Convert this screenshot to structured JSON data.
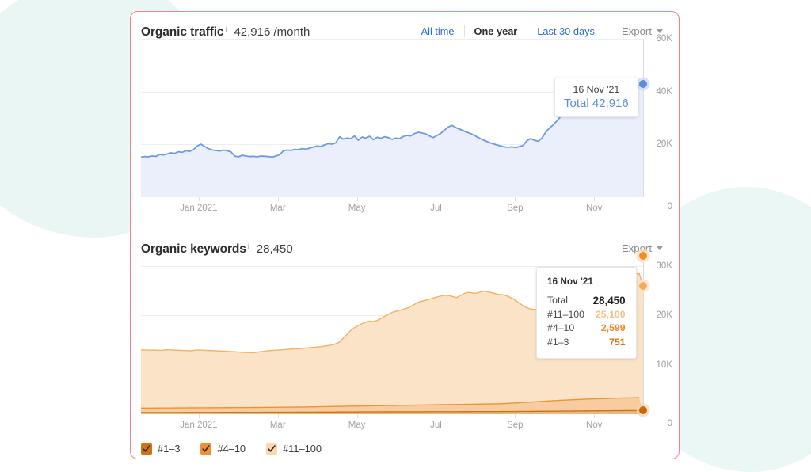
{
  "traffic": {
    "title": "Organic traffic",
    "info_icon": "i",
    "metric": "42,916 /month",
    "ranges": [
      {
        "label": "All time",
        "selected": false
      },
      {
        "label": "One year",
        "selected": true
      },
      {
        "label": "Last 30 days",
        "selected": false
      }
    ],
    "export_label": "Export",
    "tooltip": {
      "date": "16 Nov '21",
      "total_label": "Total",
      "total_value": "42,916"
    }
  },
  "keywords": {
    "title": "Organic keywords",
    "info_icon": "i",
    "metric": "28,450",
    "export_label": "Export",
    "tooltip": {
      "date": "16 Nov '21",
      "rows": [
        {
          "label": "Total",
          "value": "28,450",
          "color": "#1d1d1d"
        },
        {
          "label": "#11–100",
          "value": "25,100",
          "color": "#f5c08a"
        },
        {
          "label": "#4–10",
          "value": "2,599",
          "color": "#f18a2b"
        },
        {
          "label": "#1–3",
          "value": "751",
          "color": "#d9760f"
        }
      ]
    },
    "legend": [
      {
        "label": "#1–3",
        "color": "#cf7310",
        "checked": true
      },
      {
        "label": "#4–10",
        "color": "#f2912f",
        "checked": true
      },
      {
        "label": "#11–100",
        "color": "#fbd7ab",
        "checked": true
      }
    ]
  },
  "colors": {
    "card_border": "#f2828e",
    "blob": "#e9f6f4",
    "traffic_line": "#6d9ae0",
    "traffic_fill": "#eaeffb",
    "kw_11_100": "#fbe3c8",
    "kw_4_10": "#f7cda0",
    "kw_1_3": "#e08a2a",
    "link": "#2d6cdf"
  },
  "chart_data": [
    {
      "type": "area",
      "title": "Organic traffic",
      "subtitle": "42,916 /month",
      "xlabel": "",
      "ylabel": "",
      "ylim": [
        0,
        60000
      ],
      "yticks": [
        "0",
        "20K",
        "40K",
        "60K"
      ],
      "ytick_values": [
        0,
        20000,
        40000,
        60000
      ],
      "xticks": [
        "Jan 2021",
        "Mar",
        "May",
        "Jul",
        "Sep",
        "Nov"
      ],
      "grid": true,
      "legend_position": "none",
      "annotations": [
        {
          "date": "16 Nov '21",
          "label": "Total",
          "value": 42916
        }
      ],
      "series": [
        {
          "name": "Total",
          "color": "#6d9ae0",
          "values": [
            15200,
            15400,
            15300,
            15600,
            15500,
            16200,
            16000,
            16400,
            16800,
            16600,
            17200,
            17000,
            17600,
            17400,
            18000,
            19400,
            20100,
            19200,
            18400,
            17900,
            17700,
            17500,
            17900,
            17600,
            17200,
            15600,
            15300,
            15900,
            15600,
            15400,
            15500,
            15300,
            15600,
            15500,
            15400,
            15200,
            15600,
            16100,
            17600,
            17900,
            17700,
            18100,
            18000,
            18400,
            18200,
            18600,
            19000,
            19400,
            19200,
            19800,
            20300,
            20100,
            20600,
            22900,
            22000,
            22400,
            22200,
            23200,
            21600,
            22800,
            22400,
            23100,
            21800,
            22700,
            22300,
            22900,
            22600,
            21900,
            22400,
            22200,
            23000,
            23400,
            23200,
            24100,
            24600,
            24300,
            24000,
            23200,
            22600,
            23400,
            24200,
            25400,
            26600,
            27200,
            26400,
            25800,
            25200,
            24600,
            24100,
            23400,
            22600,
            21900,
            21300,
            20700,
            20200,
            19800,
            19400,
            19100,
            18900,
            19100,
            18800,
            19200,
            19600,
            21400,
            22200,
            21600,
            21200,
            22400,
            24600,
            26200,
            27400,
            28900,
            30600,
            31900,
            32800,
            33600,
            33200,
            34400,
            35600,
            36400,
            35600,
            34800,
            35800,
            36600,
            37400,
            38600,
            39400,
            40200,
            41400,
            40600,
            39800,
            40600,
            41800,
            42400,
            42916
          ]
        }
      ]
    },
    {
      "type": "stacked-area",
      "title": "Organic keywords",
      "subtitle": "28,450",
      "xlabel": "",
      "ylabel": "",
      "ylim": [
        0,
        32000
      ],
      "yticks": [
        "0",
        "10K",
        "20K",
        "30K"
      ],
      "ytick_values": [
        0,
        10000,
        20000,
        30000
      ],
      "xticks": [
        "Jan 2021",
        "Mar",
        "May",
        "Jul",
        "Sep",
        "Nov"
      ],
      "grid": true,
      "legend_position": "bottom",
      "annotations": [
        {
          "date": "16 Nov '21",
          "Total": 28450,
          "#11–100": 25100,
          "#4–10": 2599,
          "#1–3": 751
        }
      ],
      "series": [
        {
          "name": "#1–3",
          "color": "#cf7310",
          "values": [
            320,
            322,
            325,
            324,
            326,
            330,
            332,
            331,
            334,
            336,
            338,
            340,
            342,
            344,
            346,
            345,
            348,
            350,
            352,
            354,
            356,
            358,
            360,
            362,
            364,
            366,
            368,
            370,
            372,
            374,
            376,
            378,
            380,
            382,
            384,
            386,
            388,
            390,
            392,
            394,
            396,
            398,
            400,
            404,
            408,
            412,
            416,
            420,
            424,
            428,
            432,
            436,
            440,
            444,
            448,
            452,
            456,
            460,
            464,
            468,
            470,
            472,
            474,
            476,
            478,
            480,
            482,
            484,
            486,
            488,
            490,
            492,
            494,
            496,
            498,
            500,
            502,
            504,
            506,
            508,
            510,
            512,
            514,
            516,
            518,
            520,
            522,
            524,
            526,
            528,
            530,
            532,
            534,
            536,
            538,
            540,
            545,
            550,
            555,
            560,
            565,
            570,
            575,
            580,
            585,
            590,
            595,
            600,
            605,
            612,
            618,
            624,
            630,
            636,
            642,
            648,
            654,
            660,
            666,
            672,
            678,
            684,
            690,
            696,
            702,
            708,
            714,
            720,
            726,
            732,
            738,
            744,
            751
          ]
        },
        {
          "name": "#4–10",
          "color": "#f2912f",
          "values": [
            900,
            905,
            908,
            910,
            912,
            915,
            918,
            920,
            922,
            925,
            928,
            930,
            932,
            935,
            938,
            940,
            942,
            945,
            948,
            950,
            952,
            955,
            958,
            960,
            962,
            965,
            968,
            970,
            975,
            980,
            985,
            990,
            995,
            1000,
            1005,
            1010,
            1015,
            1020,
            1025,
            1030,
            1035,
            1040,
            1045,
            1050,
            1060,
            1070,
            1080,
            1090,
            1100,
            1110,
            1120,
            1130,
            1140,
            1150,
            1160,
            1170,
            1180,
            1190,
            1200,
            1210,
            1220,
            1230,
            1240,
            1250,
            1260,
            1270,
            1280,
            1290,
            1300,
            1310,
            1320,
            1330,
            1340,
            1350,
            1360,
            1370,
            1380,
            1390,
            1400,
            1410,
            1420,
            1430,
            1440,
            1450,
            1460,
            1470,
            1480,
            1490,
            1500,
            1510,
            1520,
            1530,
            1540,
            1550,
            1560,
            1580,
            1620,
            1660,
            1700,
            1740,
            1780,
            1820,
            1860,
            1900,
            1940,
            1980,
            2020,
            2060,
            2100,
            2140,
            2180,
            2210,
            2240,
            2270,
            2300,
            2330,
            2360,
            2390,
            2410,
            2430,
            2450,
            2470,
            2490,
            2505,
            2520,
            2535,
            2550,
            2560,
            2570,
            2580,
            2590,
            2599
          ]
        },
        {
          "name": "#11–100",
          "color": "#fbd7ab",
          "values": [
            11800,
            11750,
            11700,
            11720,
            11680,
            11640,
            11700,
            11760,
            11720,
            11680,
            11640,
            11600,
            11560,
            11520,
            11600,
            11680,
            11640,
            11600,
            11560,
            11520,
            11480,
            11440,
            11400,
            11350,
            11300,
            11250,
            11200,
            11150,
            11100,
            11050,
            11100,
            11200,
            11300,
            11400,
            11450,
            11500,
            11550,
            11600,
            11650,
            11700,
            11750,
            11800,
            11850,
            11900,
            11950,
            12000,
            12050,
            12100,
            12200,
            12300,
            12400,
            12600,
            12900,
            13600,
            14400,
            15200,
            15800,
            16200,
            16600,
            16900,
            17100,
            17000,
            17200,
            17600,
            18000,
            18400,
            18800,
            19000,
            19200,
            19400,
            19600,
            20000,
            20400,
            20800,
            21000,
            21200,
            21400,
            21600,
            21800,
            22000,
            22100,
            22000,
            21800,
            21600,
            22000,
            22400,
            22600,
            22500,
            22400,
            22600,
            22800,
            22700,
            22500,
            22300,
            22100,
            22000,
            21800,
            21400,
            21000,
            20400,
            19800,
            19300,
            18900,
            18700,
            18600,
            18700,
            18900,
            19200,
            19600,
            20000,
            20400,
            20800,
            21200,
            21600,
            22000,
            22400,
            22800,
            23100,
            23400,
            23600,
            23800,
            24000,
            24200,
            24300,
            24400,
            24500,
            24600,
            24700,
            24800,
            24900,
            25000,
            25050,
            25100
          ]
        }
      ]
    }
  ]
}
